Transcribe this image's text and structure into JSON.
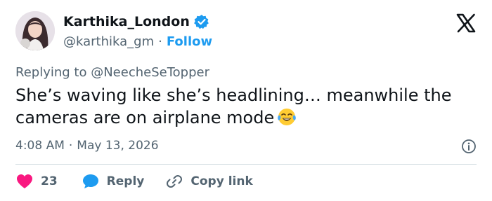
{
  "author": {
    "display_name": "Karthika_London",
    "handle": "@karthika_gm",
    "separator": "·",
    "follow_label": "Follow",
    "verified": true
  },
  "reply": {
    "prefix": "Replying to",
    "mention": "@NeecheSeTopper"
  },
  "tweet": {
    "text": "She’s waving like she’s headlining… meanwhile the cameras are on airplane mode",
    "emoji": "face-with-tears-of-joy"
  },
  "meta": {
    "time": "4:08 AM",
    "separator": "·",
    "date": "May 13, 2026"
  },
  "actions": {
    "like_count": "23",
    "reply_label": "Reply",
    "copy_label": "Copy link"
  },
  "colors": {
    "text": "#0f1419",
    "secondary": "#536471",
    "accent": "#1d9bf0",
    "like": "#f91880",
    "divider": "#cfd9de"
  }
}
